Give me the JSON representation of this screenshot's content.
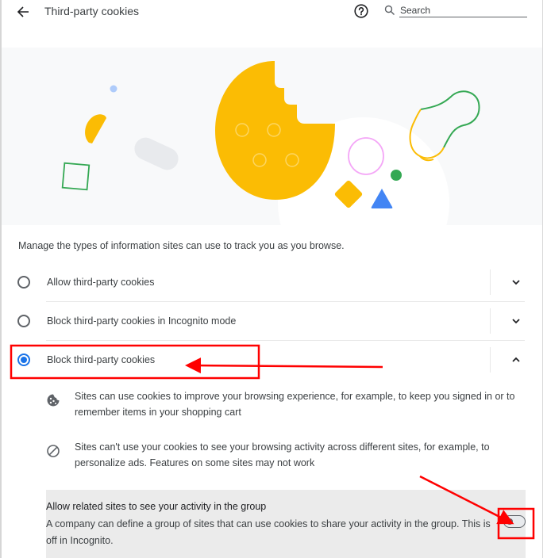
{
  "header": {
    "title": "Third-party cookies",
    "back_icon": "arrow-back-icon",
    "help_icon": "help-circle-icon",
    "search_placeholder": "Search",
    "search_value": ""
  },
  "banner": {
    "illustration": "cookie-illustration",
    "colors": {
      "background": "#f8f9fa",
      "cookie": "#fbbc04",
      "green": "#34a853",
      "blue": "#4285f4",
      "light_blue": "#aecbfa",
      "pink": "#f4a7f7",
      "gray_pill": "#e8eaed"
    }
  },
  "intro": "Manage the types of information sites can use to track you as you browse.",
  "options": [
    {
      "label": "Allow third-party cookies",
      "checked": false,
      "expanded": false
    },
    {
      "label": "Block third-party cookies in Incognito mode",
      "checked": false,
      "expanded": false
    },
    {
      "label": "Block third-party cookies",
      "checked": true,
      "expanded": true
    }
  ],
  "details": [
    {
      "icon": "cookie-icon",
      "text": "Sites can use cookies to improve your browsing experience, for example, to keep you signed in or to remember items in your shopping cart"
    },
    {
      "icon": "block-icon",
      "text": "Sites can't use your cookies to see your browsing activity across different sites, for example, to personalize ads. Features on some sites may not work"
    }
  ],
  "related_sites": {
    "title": "Allow related sites to see your activity in the group",
    "description": "A company can define a group of sites that can use cookies to share your activity in the group. This is off in Incognito.",
    "enabled": false
  },
  "colors": {
    "accent": "#1a73e8",
    "annotation": "#ff0000"
  }
}
